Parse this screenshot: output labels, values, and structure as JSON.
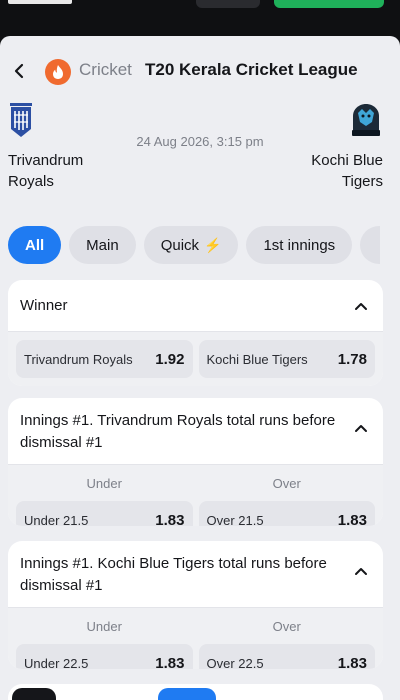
{
  "header": {
    "sport": "Cricket",
    "league": "T20 Kerala Cricket League"
  },
  "match": {
    "home_team": "Trivandrum Royals",
    "away_team": "Kochi Blue Tigers",
    "datetime": "24 Aug 2026, 3:15 pm"
  },
  "tabs": [
    {
      "label": "All"
    },
    {
      "label": "Main"
    },
    {
      "label": "Quick"
    },
    {
      "label": "1st innings"
    }
  ],
  "markets": {
    "winner": {
      "title": "Winner",
      "outcomes": [
        {
          "label": "Trivandrum Royals",
          "odds": "1.92"
        },
        {
          "label": "Kochi Blue Tigers",
          "odds": "1.78"
        }
      ]
    },
    "innings1_home": {
      "title": "Innings #1. Trivandrum Royals total runs before dismissal #1",
      "under_header": "Under",
      "over_header": "Over",
      "outcomes": [
        {
          "label": "Under 21.5",
          "odds": "1.83"
        },
        {
          "label": "Over 21.5",
          "odds": "1.83"
        }
      ]
    },
    "innings1_away": {
      "title": "Innings #1. Kochi Blue Tigers total runs before dismissal #1",
      "under_header": "Under",
      "over_header": "Over",
      "outcomes": [
        {
          "label": "Under 22.5",
          "odds": "1.83"
        },
        {
          "label": "Over 22.5",
          "odds": "1.83"
        }
      ]
    }
  },
  "colors": {
    "accent": "#1f7bf2",
    "sport_icon": "#f06a2f",
    "signup": "#1fb15a"
  }
}
